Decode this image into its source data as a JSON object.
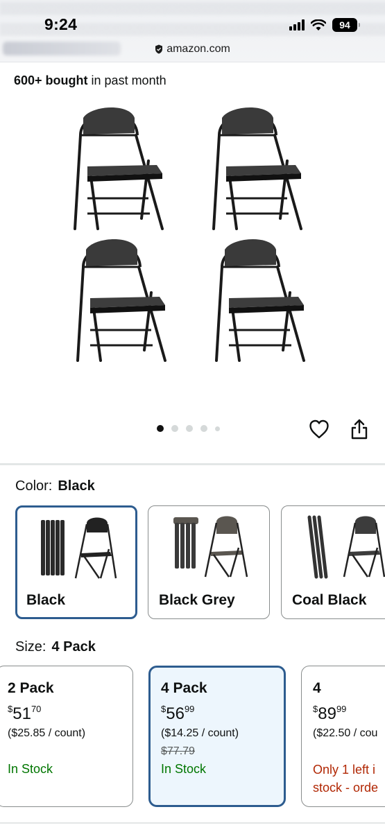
{
  "status_bar": {
    "time": "9:24",
    "battery": "94"
  },
  "browser": {
    "domain": "amazon.com"
  },
  "product": {
    "bought_bold": "600+ bought",
    "bought_rest": "in past month",
    "gallery_count": 5,
    "gallery_active_index": 0
  },
  "color": {
    "label": "Color:",
    "selected": "Black",
    "options": [
      {
        "name": "Black"
      },
      {
        "name": "Black Grey"
      },
      {
        "name": "Coal Black"
      }
    ]
  },
  "size": {
    "label": "Size:",
    "selected": "4 Pack",
    "options": [
      {
        "name": "2 Pack",
        "currency": "$",
        "whole": "51",
        "fraction": "70",
        "per_count": "($25.85 / count)",
        "was": "",
        "stock": "In Stock"
      },
      {
        "name": "4 Pack",
        "currency": "$",
        "whole": "56",
        "fraction": "99",
        "per_count": "($14.25 / count)",
        "was": "$77.79",
        "stock": "In Stock"
      },
      {
        "name": "4",
        "currency": "$",
        "whole": "89",
        "fraction": "99",
        "per_count": "($22.50 / cou",
        "was": "",
        "stock": "Only 1 left i stock - orde"
      }
    ]
  },
  "colors": {
    "selected_border": "#2d5c8f",
    "in_stock": "#007600",
    "low_stock": "#b12704",
    "selected_bg": "#edf6fd"
  }
}
